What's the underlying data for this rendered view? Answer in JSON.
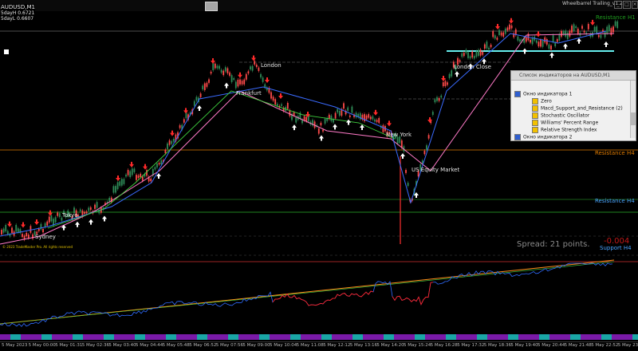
{
  "window": {
    "symbol_label": "AUDUSD,M1",
    "info_line_1": "5dayH 0.6721",
    "info_line_2": "5dayL 0.6607",
    "indicator_title": "Wheelbarrel Trailing_v1.2"
  },
  "chart_labels": {
    "sydney": "Sydney",
    "tokyo": "Tokyo",
    "frankfurt": "Frankfurt",
    "london": "London",
    "new_york": "New York",
    "us_equity": "US Equity Market",
    "london_close": "London Close",
    "resistance_h1": "Resistance H1",
    "resistance_h4": "Resistance H4",
    "resistance_h4_lower": "Resistance H4",
    "support_h4": "Support H4",
    "red_value": "-0.004",
    "spread": "Spread: 21 points.",
    "copyright": "© 2023 TradeMaster Pro. All rights reserved"
  },
  "indicator_panel": {
    "title": "Список индикаторов на AUDUSD,M1",
    "window1": "Окно индикатора 1",
    "items1": [
      "Zero",
      "Macd_Support_and_Resistance (2)",
      "Stochastic Oscillator",
      "Williams' Percent Range",
      "Relative Strength Index"
    ],
    "window2": "Окно индикатора 2"
  },
  "time_axis": [
    "5 May 2023",
    "5 May 00:00",
    "5 May 01:31",
    "5 May 02:36",
    "5 May 03:40",
    "5 May 04:44",
    "5 May 05:48",
    "5 May 06:52",
    "5 May 07:56",
    "5 May 09:00",
    "5 May 10:04",
    "5 May 11:08",
    "5 May 12:12",
    "5 May 13:16",
    "5 May 14:20",
    "5 May 15:24",
    "5 May 16:28",
    "5 May 17:32",
    "5 May 18:36",
    "5 May 19:40",
    "5 May 20:44",
    "5 May 21:48",
    "5 May 22:52",
    "5 May 23:57"
  ],
  "colors": {
    "background": "#000000",
    "candle_up": "#2e8b57",
    "candle_down": "#ff4a4a",
    "resistance_orange": "#e07b00",
    "support_green": "#2bb32b",
    "label_blue": "#4aa3ff",
    "trend_pink": "#ff7ac8",
    "trend_blue": "#3a6bff",
    "osc_blue": "#2f6cff",
    "osc_red": "#ff2020",
    "osc_orange": "#ff8c1a",
    "hist_purple": "#7a1aa8",
    "hist_teal": "#1aa6a6"
  }
}
